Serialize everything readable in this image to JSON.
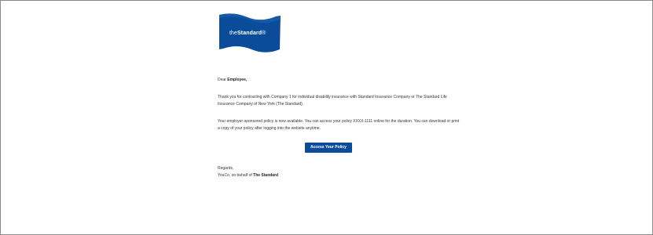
{
  "logo": {
    "prefix": "the",
    "brand": "Standard",
    "registered": "®",
    "color": "#0a4c9a"
  },
  "email": {
    "greeting_prefix": "Dear",
    "greeting_name": "Employee,",
    "para1_a": "Thank you for contracting with Company 1 for individual disability insurance with ",
    "para1_b": "Standard Insurance Company",
    "para1_c": " or The Standard Life Insurance Company of New York (The Standard).",
    "para2": "Your employer-sponsored policy is now available. You can access your policy XXXX-1111 online for the duration. You can download or print a copy of your policy after logging into the website anytime.",
    "cta_label": "Access Your Policy",
    "regards": "Regards,",
    "signoff_prefix": "YouCo, on behalf of ",
    "signoff_name": "The Standard"
  }
}
